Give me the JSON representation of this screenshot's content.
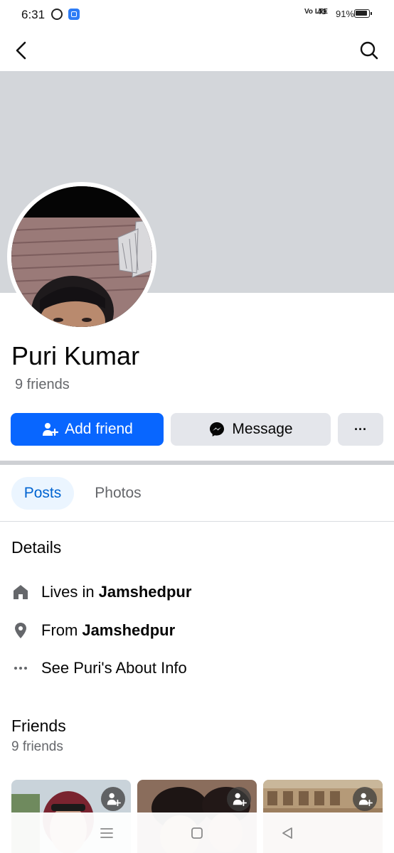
{
  "status_bar": {
    "time": "6:31",
    "network": "Vo LTE",
    "signal": "4G",
    "battery": "91%"
  },
  "nav": {
    "back_icon": "back-chevron-icon",
    "search_icon": "search-icon"
  },
  "profile": {
    "name": "Puri Kumar",
    "friends_count": "9 friends"
  },
  "actions": {
    "add_friend": "Add friend",
    "message": "Message",
    "more": "···"
  },
  "tabs": [
    {
      "label": "Posts",
      "active": true
    },
    {
      "label": "Photos",
      "active": false
    }
  ],
  "details": {
    "title": "Details",
    "lives_prefix": "Lives in",
    "lives_place": "Jamshedpur",
    "from_prefix": "From",
    "from_place": "Jamshedpur",
    "about": "See Puri's About Info"
  },
  "friends": {
    "title": "Friends",
    "count": "9 friends"
  },
  "colors": {
    "accent": "#0866ff",
    "cover": "#d3d6da",
    "secondary_button": "#e4e6eb",
    "active_tab_bg": "#ebf5ff",
    "active_tab_text": "#0064d1"
  }
}
